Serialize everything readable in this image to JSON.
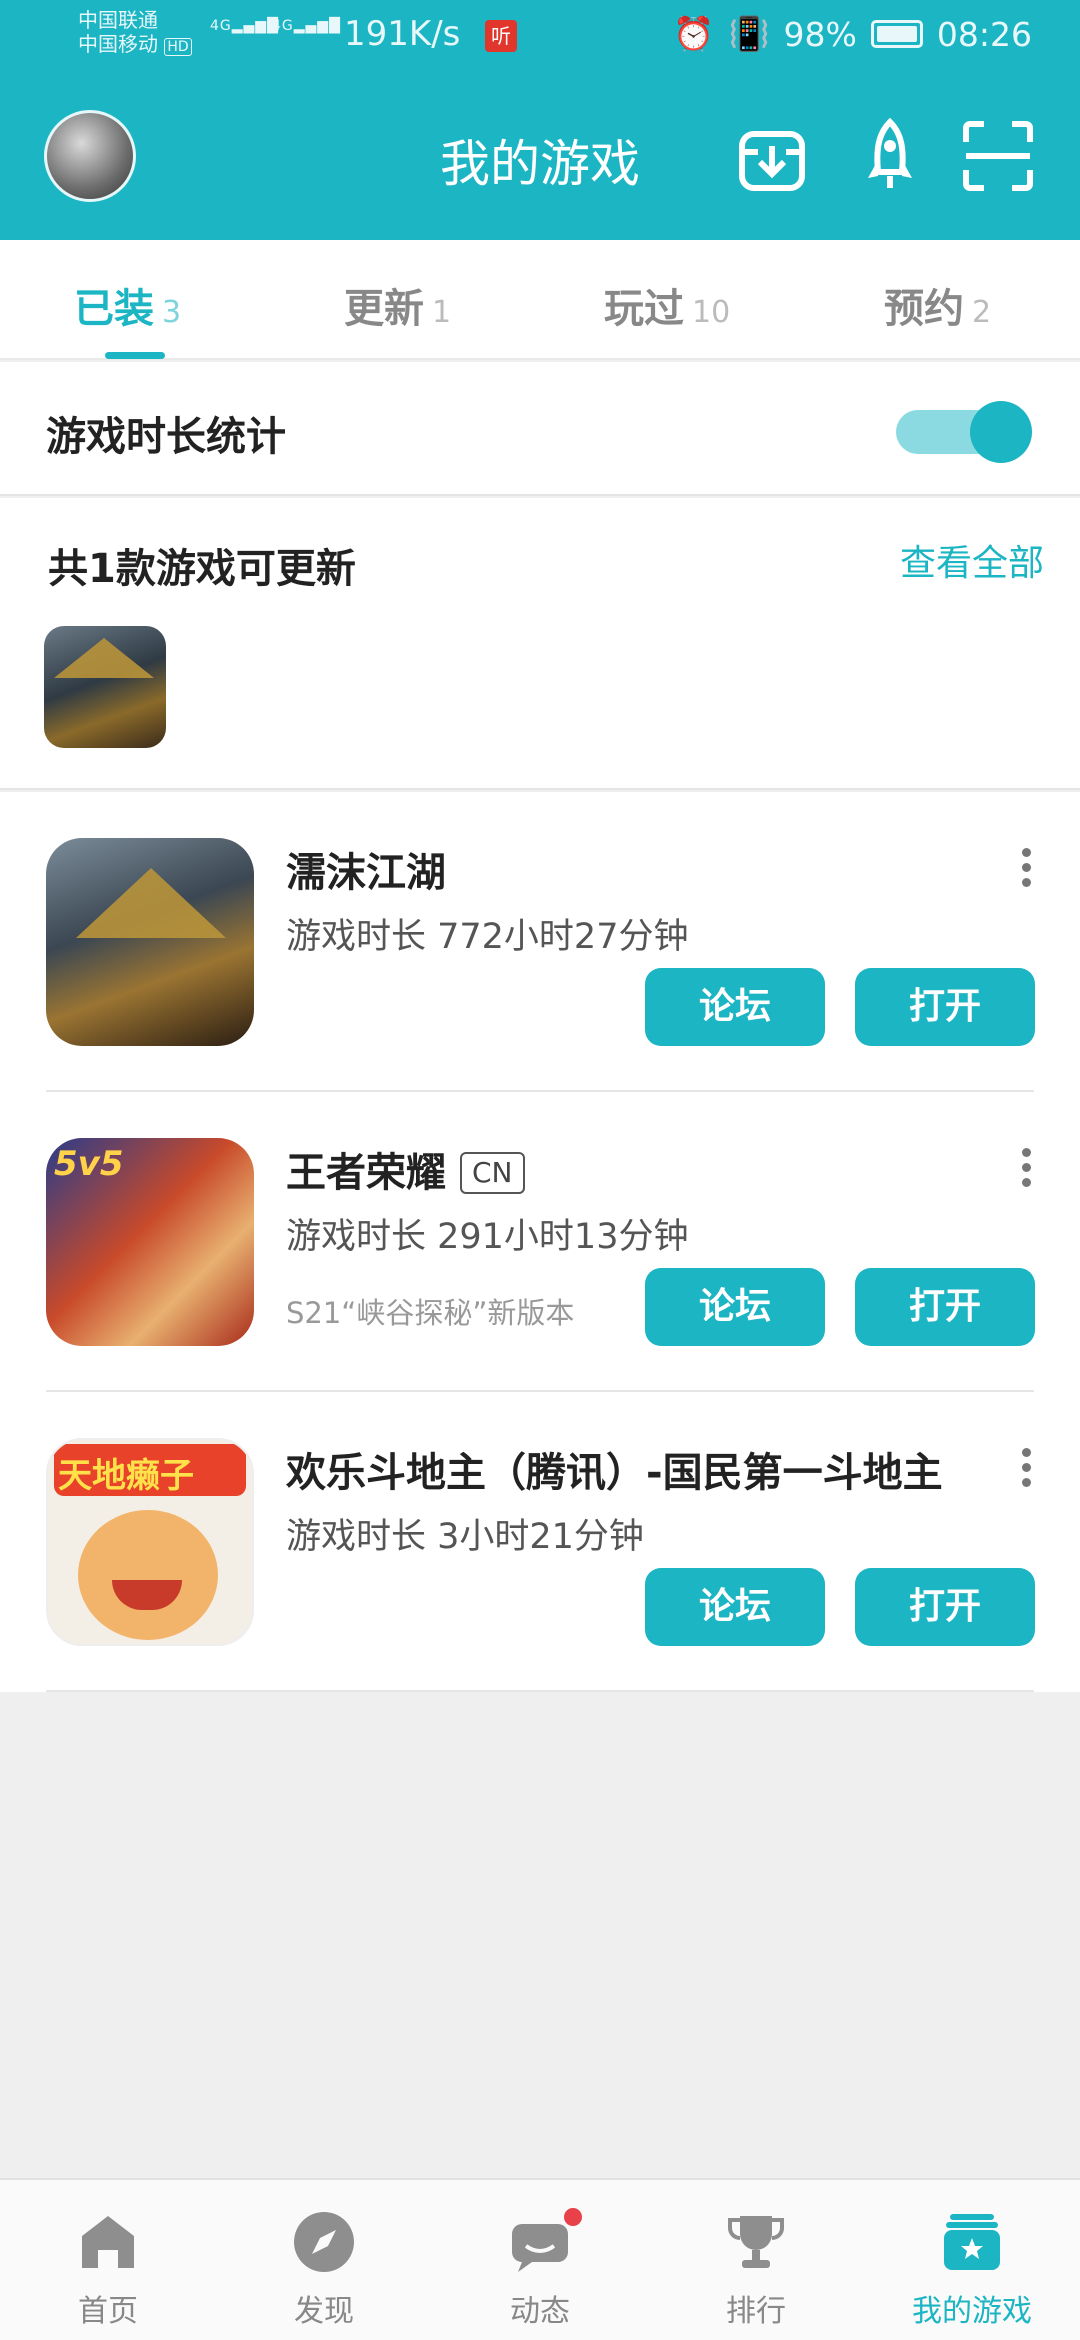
{
  "status_bar": {
    "carrier1": "中国联通",
    "carrier2": "中国移动",
    "hd": "HD",
    "net1": "4G",
    "net2": "4G",
    "speed": "191K/s",
    "notif_icon": "听",
    "battery": "98%",
    "time": "08:26"
  },
  "header": {
    "title": "我的游戏",
    "icons": [
      "download-icon",
      "rocket-icon",
      "scan-icon"
    ]
  },
  "tabs": [
    {
      "label": "已装",
      "count": "3",
      "active": true
    },
    {
      "label": "更新",
      "count": "1"
    },
    {
      "label": "玩过",
      "count": "10"
    },
    {
      "label": "预约",
      "count": "2"
    }
  ],
  "stat": {
    "label": "游戏时长统计",
    "enabled": true
  },
  "updates": {
    "label": "共1款游戏可更新",
    "view_all": "查看全部"
  },
  "games": [
    {
      "name": "濡沫江湖",
      "badge": "",
      "duration": "游戏时长 772小时27分钟",
      "note": "",
      "forum": "论坛",
      "open": "打开"
    },
    {
      "name": "王者荣耀",
      "badge": "CN",
      "duration": "游戏时长 291小时13分钟",
      "note": "S21“峡谷探秘”新版本",
      "forum": "论坛",
      "open": "打开"
    },
    {
      "name": "欢乐斗地主（腾讯）-国民第一斗地主",
      "badge": "",
      "duration": "游戏时长 3小时21分钟",
      "note": "",
      "forum": "论坛",
      "open": "打开"
    }
  ],
  "icon_text": {
    "wz": "5v5",
    "ddz": "天地癞子"
  },
  "bottom_nav": [
    {
      "label": "首页",
      "icon": "home-icon"
    },
    {
      "label": "发现",
      "icon": "compass-icon"
    },
    {
      "label": "动态",
      "icon": "chat-icon"
    },
    {
      "label": "排行",
      "icon": "trophy-icon"
    },
    {
      "label": "我的游戏",
      "icon": "my-games-icon",
      "active": true
    }
  ],
  "colors": {
    "accent": "#1cb5c3",
    "badge_red": "#e0362b"
  }
}
